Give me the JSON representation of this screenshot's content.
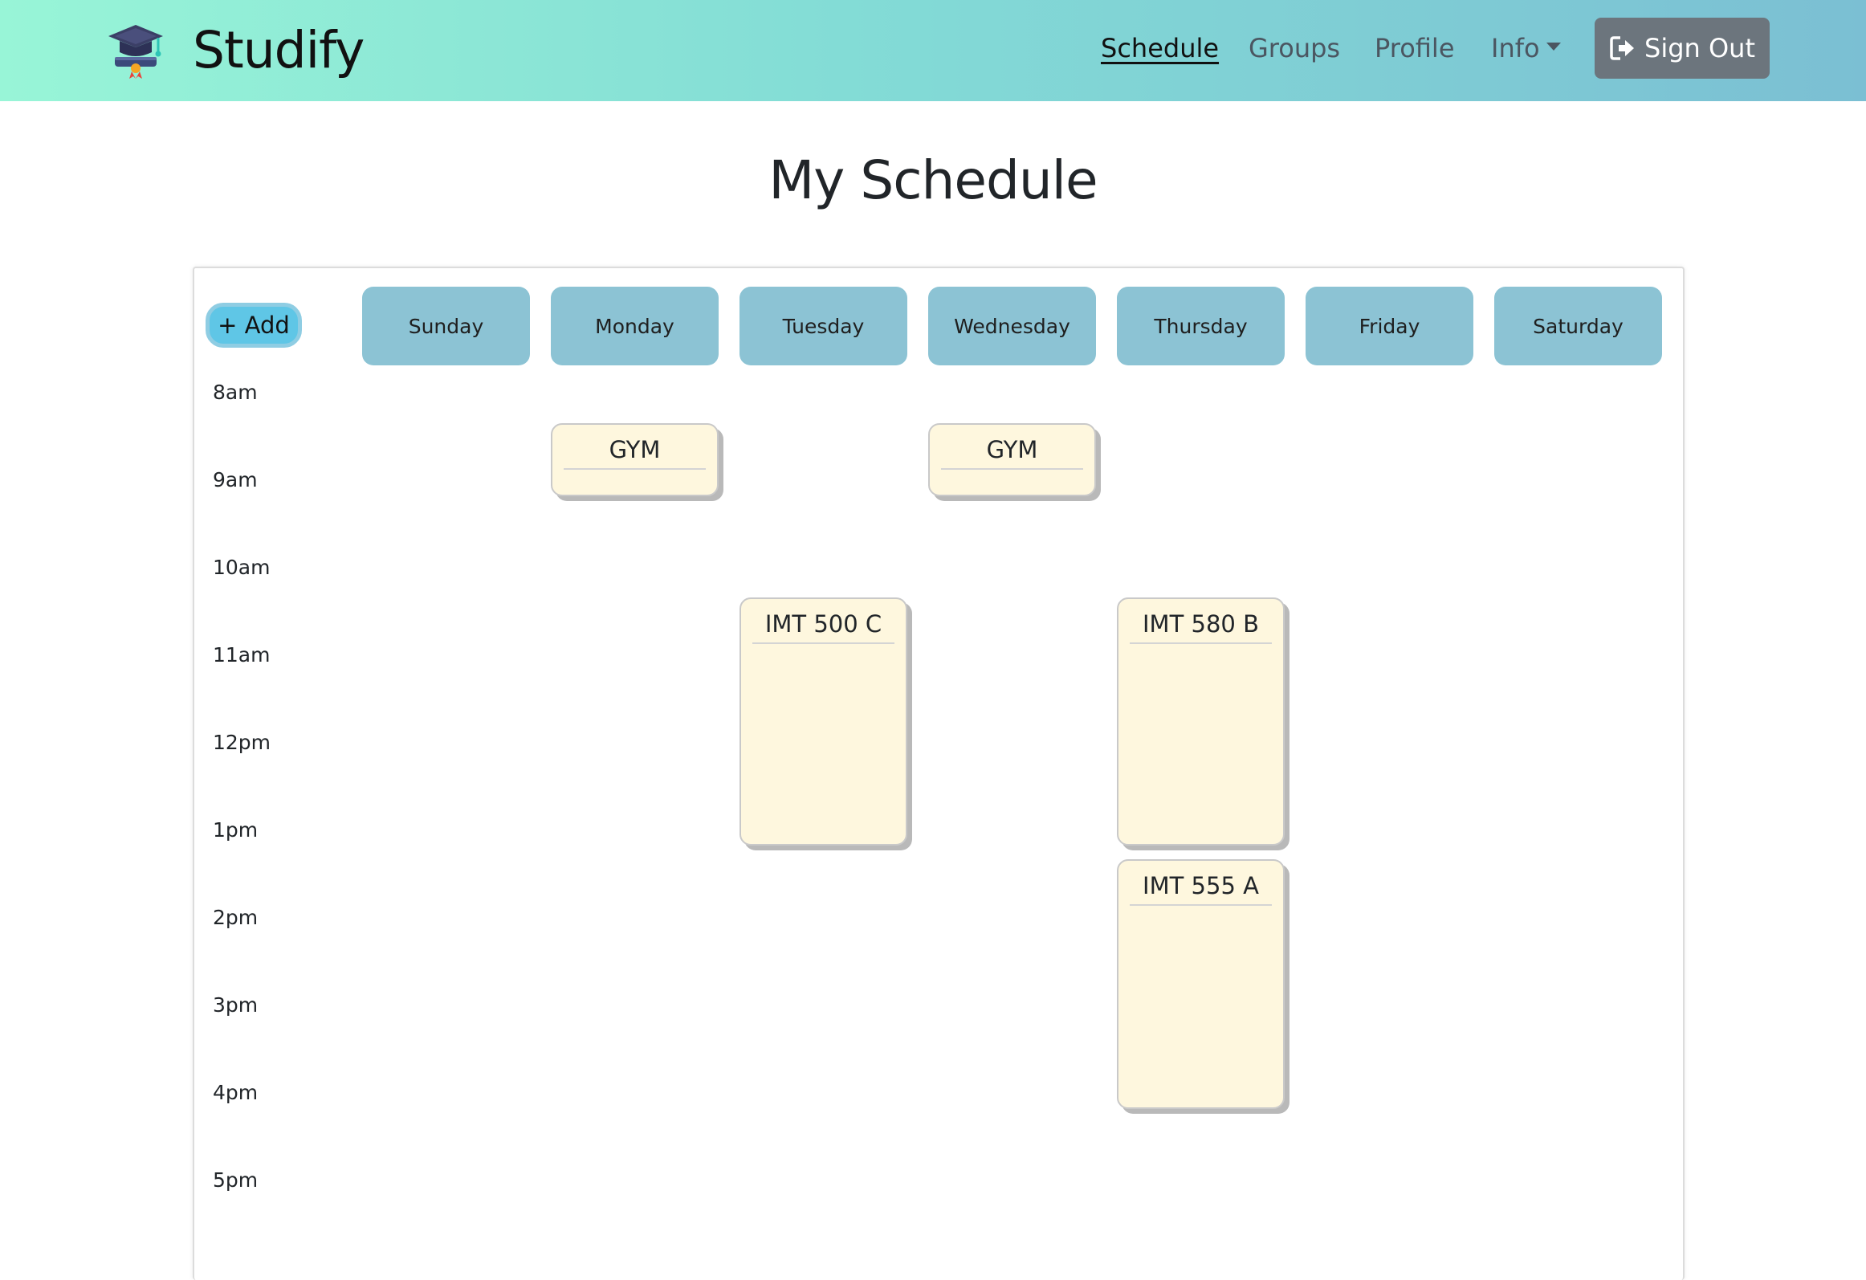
{
  "navbar": {
    "brand": "Studify",
    "links": {
      "schedule": "Schedule",
      "groups": "Groups",
      "profile": "Profile",
      "info": "Info"
    },
    "sign_out": "Sign Out"
  },
  "page": {
    "title": "My Schedule"
  },
  "calendar": {
    "add_label": "+ Add",
    "days": [
      "Sunday",
      "Monday",
      "Tuesday",
      "Wednesday",
      "Thursday",
      "Friday",
      "Saturday"
    ],
    "times": [
      "8am",
      "9am",
      "10am",
      "11am",
      "12pm",
      "1pm",
      "2pm",
      "3pm",
      "4pm",
      "5pm"
    ],
    "events": [
      {
        "title": "GYM",
        "day": "Monday"
      },
      {
        "title": "GYM",
        "day": "Wednesday"
      },
      {
        "title": "IMT 500 C",
        "day": "Tuesday"
      },
      {
        "title": "IMT 580 B",
        "day": "Thursday"
      },
      {
        "title": "IMT 555 A",
        "day": "Thursday"
      }
    ]
  },
  "colors": {
    "navbar_gradient": [
      "#98f5d7",
      "#7bbfd3"
    ],
    "day_header": "#8cc3d4",
    "event_bg": "#fef7de",
    "sign_out_bg": "#6c757d",
    "add_bg": "#5fc6e6"
  }
}
